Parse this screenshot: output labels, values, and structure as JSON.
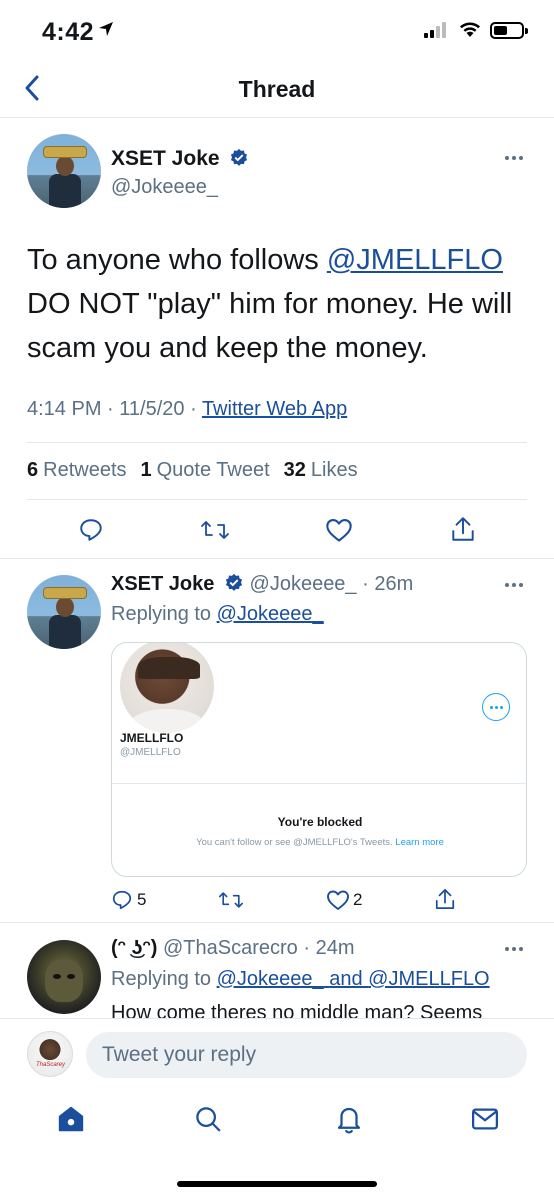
{
  "status_bar": {
    "time": "4:42"
  },
  "header": {
    "title": "Thread"
  },
  "main_tweet": {
    "name": "XSET Joke",
    "handle": "@Jokeeee_",
    "text_part1": "To anyone who follows ",
    "mention": "@JMELLFLO",
    "text_part2": " DO NOT \"play\" him for money. He will scam you and keep the money.",
    "time": "4:14 PM",
    "date": "11/5/20",
    "app": "Twitter Web App",
    "retweets_count": "6",
    "retweets_label": "Retweets",
    "quotes_count": "1",
    "quotes_label": "Quote Tweet",
    "likes_count": "32",
    "likes_label": "Likes"
  },
  "reply1": {
    "name": "XSET Joke",
    "handle": "@Jokeeee_",
    "time": "26m",
    "replying_label": "Replying to",
    "replying_to": "@Jokeeee_",
    "embed": {
      "name": "JMELLFLO",
      "handle": "@JMELLFLO",
      "blocked_title": "You're blocked",
      "blocked_sub": "You can't follow or see @JMELLFLO's Tweets.",
      "learn_more": "Learn more"
    },
    "reply_count": "5",
    "like_count": "2"
  },
  "reply2": {
    "name": "(ᵔ ͜ʖᵔ)",
    "handle": "@ThaScarecro",
    "time": "24m",
    "replying_label": "Replying to",
    "replying_to_1": "@Jokeeee_",
    "and": "and",
    "replying_to_2": "@JMELLFLO",
    "text": "How come theres no middle man? Seems"
  },
  "composer": {
    "placeholder": "Tweet your reply",
    "avatar_text": "ThaScarey"
  },
  "colors": {
    "link": "#1b4f9c",
    "muted": "#5b7083",
    "accent": "#1da1f2"
  },
  "icons": [
    "back-chevron-icon",
    "verified-badge-icon",
    "more-icon",
    "reply-icon",
    "retweet-icon",
    "like-icon",
    "share-icon",
    "home-icon",
    "search-icon",
    "notifications-icon",
    "messages-icon"
  ]
}
